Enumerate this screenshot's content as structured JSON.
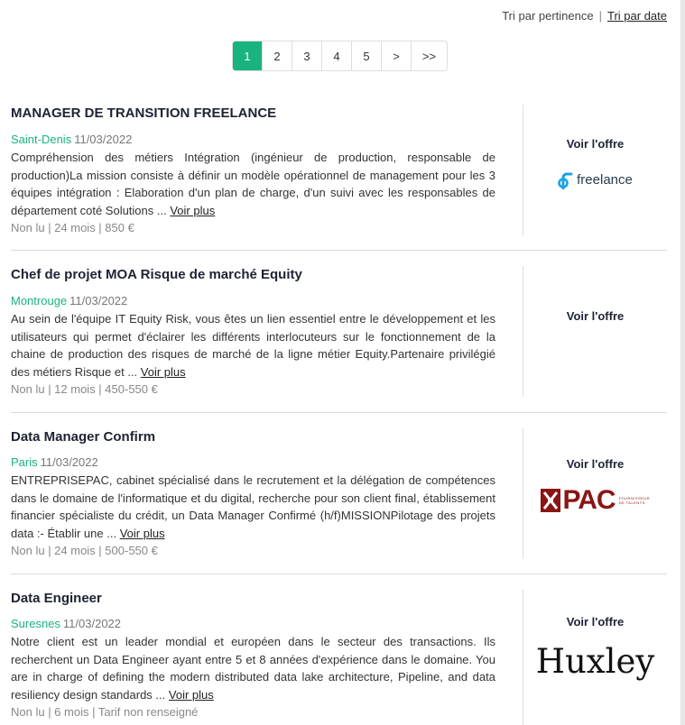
{
  "sort": {
    "relevance_label": "Tri par pertinence",
    "separator": "|",
    "date_label": "Tri par date"
  },
  "pagination": {
    "pages": [
      "1",
      "2",
      "3",
      "4",
      "5",
      ">",
      ">>"
    ],
    "active": "1"
  },
  "offers": [
    {
      "title": "MANAGER DE TRANSITION FREELANCE",
      "city": "Saint-Denis",
      "date": "11/03/2022",
      "description": "Compréhension des métiers Intégration (ingénieur de production, responsable de production)La mission consiste à définir un modèle opérationnel de management pour les 3 équipes intégration : Elaboration d'un plan de charge, d'un suivi avec les responsables de département coté Solutions ...",
      "more_label": "Voir plus",
      "info": "Non lu | 24 mois | 850 €",
      "cta_label": "Voir l'offre",
      "logo_text": "freelance",
      "logo_icon": "freelance-logo-icon"
    },
    {
      "title": "Chef de projet MOA Risque de marché Equity",
      "city": "Montrouge",
      "date": "11/03/2022",
      "description": "Au sein de l'équipe IT Equity Risk, vous êtes un lien essentiel entre le développement et les utilisateurs qui permet d'éclairer les différents interlocuteurs sur le fonctionnement de la chaine de production des risques de marché de la ligne métier Equity.Partenaire privilégié des métiers Risque et ...",
      "more_label": "Voir plus",
      "info": "Non lu | 12 mois | 450-550 €",
      "cta_label": "Voir l'offre"
    },
    {
      "title": "Data Manager Confirm",
      "city": "Paris",
      "date": "11/03/2022",
      "description": "ENTREPRISEPAC, cabinet spécialisé dans le recrutement et la délégation de compétences dans le domaine de l'informatique et du digital, recherche pour son client final, établissement financier spécialiste du crédit, un Data Manager Confirmé (h/f)MISSIONPilotage des projets data :- Établir une ...",
      "more_label": "Voir plus",
      "info": "Non lu | 24 mois | 500-550 €",
      "cta_label": "Voir l'offre",
      "logo_text": "PAC",
      "logo_tagline": "FOURNISSEUR DE TALENTS",
      "logo_color": "#8a1515"
    },
    {
      "title": "Data Engineer",
      "city": "Suresnes",
      "date": "11/03/2022",
      "description": "Notre client est un leader mondial et européen dans le secteur des transactions. Ils recherchent un Data Engineer ayant entre 5 et 8 années d'expérience dans le domaine. You are in charge of defining the modern distributed data lake architecture, Pipeline, and data resiliency design standards ...",
      "more_label": "Voir plus",
      "info": "Non lu | 6 mois | Tarif non renseigné",
      "cta_label": "Voir l'offre",
      "logo_text": "Huxley"
    }
  ],
  "colors": {
    "accent": "#19b37f",
    "title": "#1d2333",
    "divider": "#dddddd"
  }
}
